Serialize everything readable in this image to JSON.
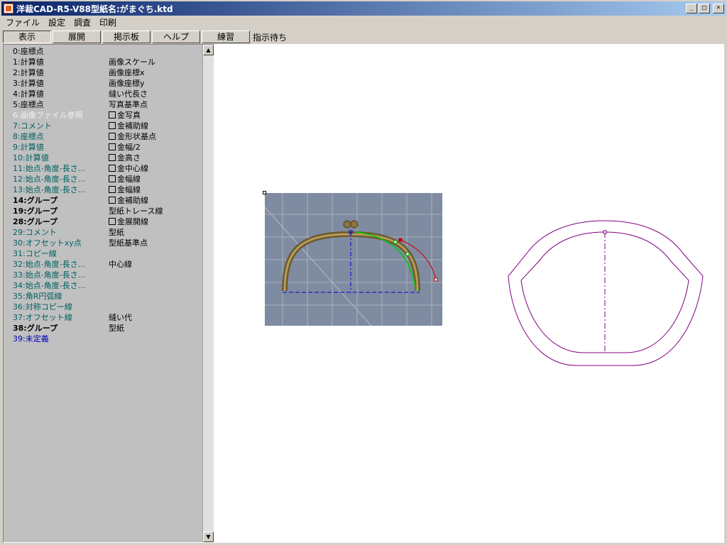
{
  "window": {
    "title": "洋裁CAD-R5-V88型紙名:がまぐち.ktd"
  },
  "menu": [
    "ファイル",
    "設定",
    "調査",
    "印刷"
  ],
  "toolbar": {
    "buttons": [
      "表示",
      "展開",
      "掲示板",
      "ヘルプ",
      "練習"
    ],
    "status": "指示待ち"
  },
  "list": [
    {
      "name": "0:座標点",
      "value": "",
      "color": "black"
    },
    {
      "name": "1:計算値",
      "value": "画像スケール",
      "color": "black"
    },
    {
      "name": "2:計算値",
      "value": "画像座標x",
      "color": "black"
    },
    {
      "name": "3:計算値",
      "value": "画像座標y",
      "color": "black"
    },
    {
      "name": "4:計算値",
      "value": "縫い代長さ",
      "color": "black"
    },
    {
      "name": "5:座標点",
      "value": "写真基準点",
      "color": "black"
    },
    {
      "name": "6:画像ファイル参照",
      "value": "金写真",
      "color": "white",
      "checkbox": true
    },
    {
      "name": "7:コメント",
      "value": "金補助線",
      "color": "teal",
      "checkbox": true
    },
    {
      "name": "8:座標点",
      "value": "金形状基点",
      "color": "teal",
      "checkbox": true
    },
    {
      "name": "9:計算値",
      "value": "金幅/2",
      "color": "teal",
      "checkbox": true
    },
    {
      "name": "10:計算値",
      "value": "金高さ",
      "color": "teal",
      "checkbox": true
    },
    {
      "name": "11:始点-角度-長さ...",
      "value": "金中心線",
      "color": "teal",
      "checkbox": true
    },
    {
      "name": "12:始点-角度-長さ...",
      "value": "金幅線",
      "color": "teal",
      "checkbox": true
    },
    {
      "name": "13:始点-角度-長さ...",
      "value": "金幅線",
      "color": "teal",
      "checkbox": true
    },
    {
      "name": "14:グループ",
      "value": "金補助線",
      "color": "black",
      "bold": true,
      "checkbox": true
    },
    {
      "name": "19:グループ",
      "value": "型紙トレース線",
      "color": "black",
      "bold": true
    },
    {
      "name": "28:グループ",
      "value": "金展開線",
      "color": "black",
      "bold": true,
      "checkbox": true
    },
    {
      "name": "29:コメント",
      "value": "型紙",
      "color": "teal"
    },
    {
      "name": "30:オフセットxy点",
      "value": "型紙基準点",
      "color": "teal"
    },
    {
      "name": "31:コピー線",
      "value": "",
      "color": "teal"
    },
    {
      "name": "32:始点-角度-長さ...",
      "value": "中心線",
      "color": "teal"
    },
    {
      "name": "33:始点-角度-長さ...",
      "value": "",
      "color": "teal"
    },
    {
      "name": "34:始点-角度-長さ...",
      "value": "",
      "color": "teal"
    },
    {
      "name": "35:角R円弧線",
      "value": "",
      "color": "teal"
    },
    {
      "name": "36:対称コピー線",
      "value": "",
      "color": "teal"
    },
    {
      "name": "37:オフセット線",
      "value": "縫い代",
      "color": "teal"
    },
    {
      "name": "38:グループ",
      "value": "型紙",
      "color": "black",
      "bold": true
    },
    {
      "name": "39:未定義",
      "value": "",
      "color": "blue"
    }
  ],
  "scrollbar": {
    "up_icon": "arrow-up-icon",
    "down_icon": "arrow-down-icon"
  },
  "colors": {
    "titlebar": "#0a246a",
    "pattern": "#800080",
    "centerline": "#0000cc",
    "trace": "#00cc00",
    "expand": "#cc0000",
    "photo_bg": "#7e8ba0",
    "clasp": "#7a6a40"
  }
}
